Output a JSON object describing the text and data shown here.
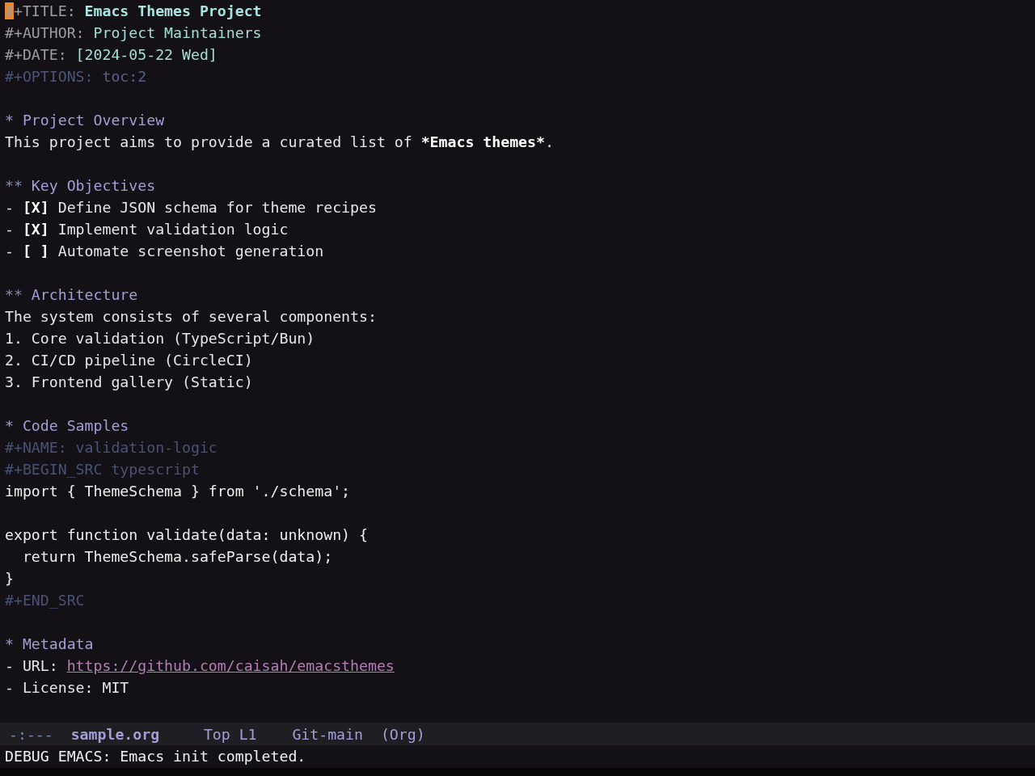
{
  "buffer": {
    "preamble": [
      {
        "keyword": "#+TITLE:",
        "value": "Emacs Themes Project",
        "kind": "title",
        "cursor": true
      },
      {
        "keyword": "#+AUTHOR:",
        "value": "Project Maintainers",
        "kind": "info",
        "cursor": false
      },
      {
        "keyword": "#+DATE:",
        "value": "[2024-05-22 Wed]",
        "kind": "info",
        "cursor": false
      },
      {
        "keyword": "#+OPTIONS:",
        "value": "toc:2",
        "kind": "meta",
        "cursor": false
      }
    ],
    "sections": [
      {
        "marker": "*",
        "title": "Project Overview",
        "body": [
          {
            "kind": "paragraph",
            "segments": [
              {
                "text": "This project aims to provide a curated list of ",
                "bold": false
              },
              {
                "text": "*Emacs themes*",
                "bold": true
              },
              {
                "text": ".",
                "bold": false
              }
            ]
          }
        ],
        "children": [
          {
            "marker": "**",
            "title": "Key Objectives",
            "body": [
              {
                "kind": "checkbox",
                "bullet": "-",
                "box": "[X]",
                "text": "Define JSON schema for theme recipes"
              },
              {
                "kind": "checkbox",
                "bullet": "-",
                "box": "[X]",
                "text": "Implement validation logic"
              },
              {
                "kind": "checkbox",
                "bullet": "-",
                "box": "[ ]",
                "text": "Automate screenshot generation"
              }
            ]
          },
          {
            "marker": "**",
            "title": "Architecture",
            "body": [
              {
                "kind": "paragraph",
                "segments": [
                  {
                    "text": "The system consists of several components:",
                    "bold": false
                  }
                ]
              },
              {
                "kind": "numbered",
                "number": "1.",
                "text": "Core validation (TypeScript/Bun)"
              },
              {
                "kind": "numbered",
                "number": "2.",
                "text": "CI/CD pipeline (CircleCI)"
              },
              {
                "kind": "numbered",
                "number": "3.",
                "text": "Frontend gallery (Static)"
              }
            ]
          }
        ]
      },
      {
        "marker": "*",
        "title": "Code Samples",
        "body": [
          {
            "kind": "src_block",
            "name_line": "#+NAME: validation-logic",
            "begin_line": "#+BEGIN_SRC typescript",
            "code": "import { ThemeSchema } from './schema';\n\nexport function validate(data: unknown) {\n  return ThemeSchema.safeParse(data);\n}",
            "end_line": "#+END_SRC"
          }
        ]
      },
      {
        "marker": "*",
        "title": "Metadata",
        "body": [
          {
            "kind": "field",
            "bullet": "-",
            "label": "URL:",
            "value": "https://github.com/caisah/emacsthemes",
            "link": true
          },
          {
            "kind": "field",
            "bullet": "-",
            "label": "License:",
            "value": "MIT",
            "link": false
          }
        ]
      }
    ]
  },
  "mode_line": [
    {
      "kind": "status",
      "text": "-:---"
    },
    {
      "kind": "buffer",
      "text": "sample.org"
    },
    {
      "kind": "position",
      "text": "Top L1"
    },
    {
      "kind": "vc",
      "text": "Git-main"
    },
    {
      "kind": "mode",
      "text": "(Org)"
    }
  ],
  "echo_area": {
    "message": "DEBUG EMACS: Emacs init completed."
  }
}
